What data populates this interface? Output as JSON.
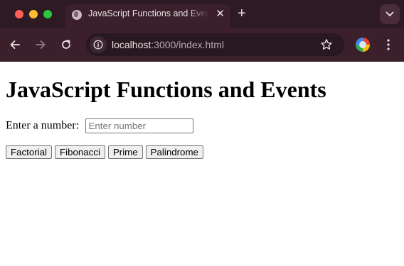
{
  "browser": {
    "tab": {
      "title": "JavaScript Functions and Events",
      "favicon": "globe-icon",
      "close": "✕"
    },
    "newtab": "+",
    "address": {
      "host": "localhost",
      "path": ":3000/index.html"
    },
    "icons": [
      "back-arrow-icon",
      "forward-arrow-icon",
      "reload-icon",
      "site-info-icon",
      "bookmark-star-icon",
      "profile-avatar-icon",
      "kebab-menu-icon",
      "chevron-down-icon"
    ],
    "colors": {
      "frame": "#2e1a22",
      "toolbar": "#3b1f2b",
      "omnibox": "#281820",
      "traffic_red": "#ff5f57",
      "traffic_yellow": "#febc2e",
      "traffic_green": "#28c840"
    }
  },
  "page": {
    "heading": "JavaScript Functions and Events",
    "input_label": "Enter a number:",
    "input_placeholder": "Enter number",
    "input_value": "",
    "buttons": [
      "Factorial",
      "Fibonacci",
      "Prime",
      "Palindrome"
    ]
  }
}
